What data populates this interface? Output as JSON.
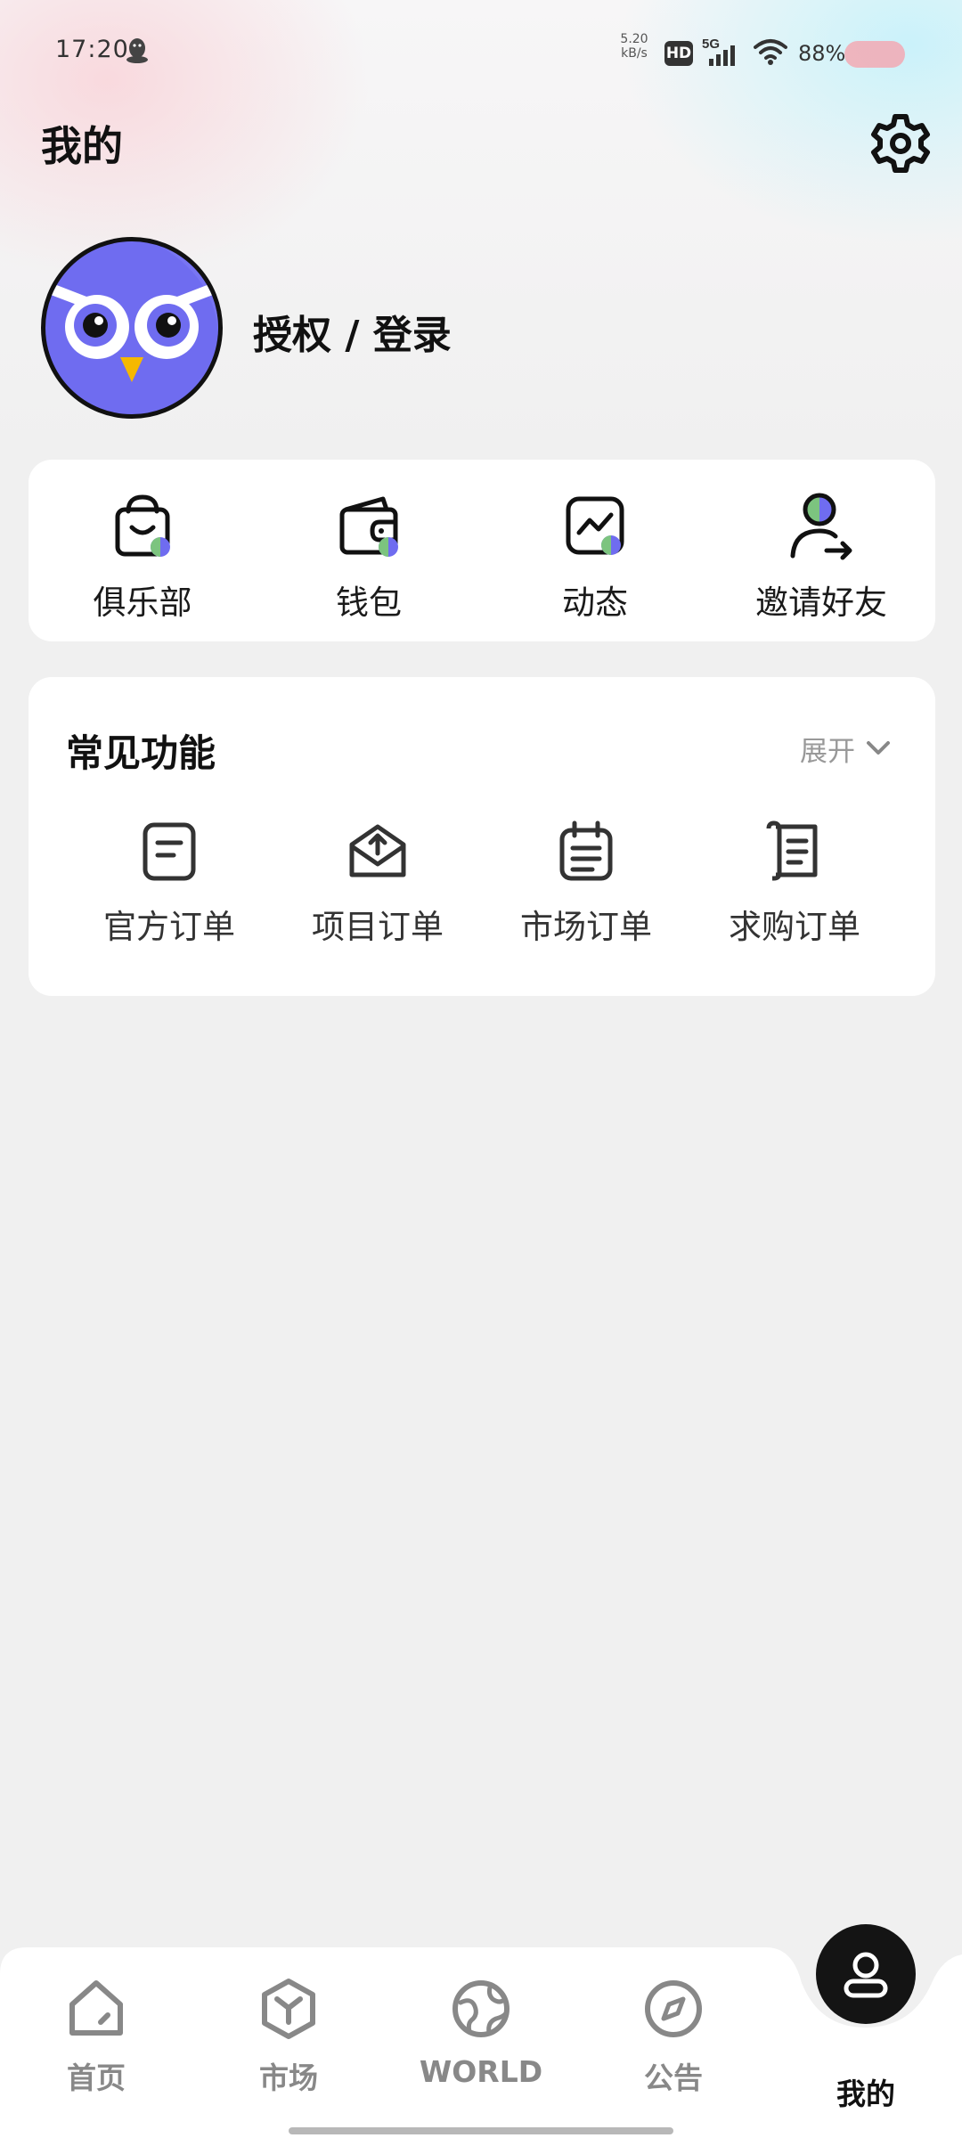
{
  "status_bar": {
    "time": "17:20",
    "net_speed_value": "5.20",
    "net_speed_unit": "kB/s",
    "hd_label": "HD",
    "network_type": "5G",
    "battery_text": "88%"
  },
  "header": {
    "title": "我的"
  },
  "profile": {
    "login_text": "授权 / 登录"
  },
  "quick_actions": [
    {
      "label": "俱乐部",
      "icon": "shopping-bag-icon"
    },
    {
      "label": "钱包",
      "icon": "wallet-icon"
    },
    {
      "label": "动态",
      "icon": "activity-chart-icon"
    },
    {
      "label": "邀请好友",
      "icon": "invite-user-icon"
    }
  ],
  "common_functions": {
    "title": "常见功能",
    "expand_label": "展开",
    "items": [
      {
        "label": "官方订单",
        "icon": "document-icon"
      },
      {
        "label": "项目订单",
        "icon": "inbox-upload-icon"
      },
      {
        "label": "市场订单",
        "icon": "calendar-list-icon"
      },
      {
        "label": "求购订单",
        "icon": "scroll-icon"
      }
    ]
  },
  "bottom_nav": {
    "items": [
      {
        "label": "首页",
        "icon": "home-icon"
      },
      {
        "label": "市场",
        "icon": "cube-icon"
      },
      {
        "label": "WORLD",
        "icon": "globe-icon"
      },
      {
        "label": "公告",
        "icon": "compass-icon"
      },
      {
        "label": "我的",
        "icon": "user-icon",
        "active": true
      }
    ]
  },
  "colors": {
    "accent_purple": "#6f6cf0",
    "accent_green": "#7cc47f",
    "owl_beak": "#f5b800"
  }
}
